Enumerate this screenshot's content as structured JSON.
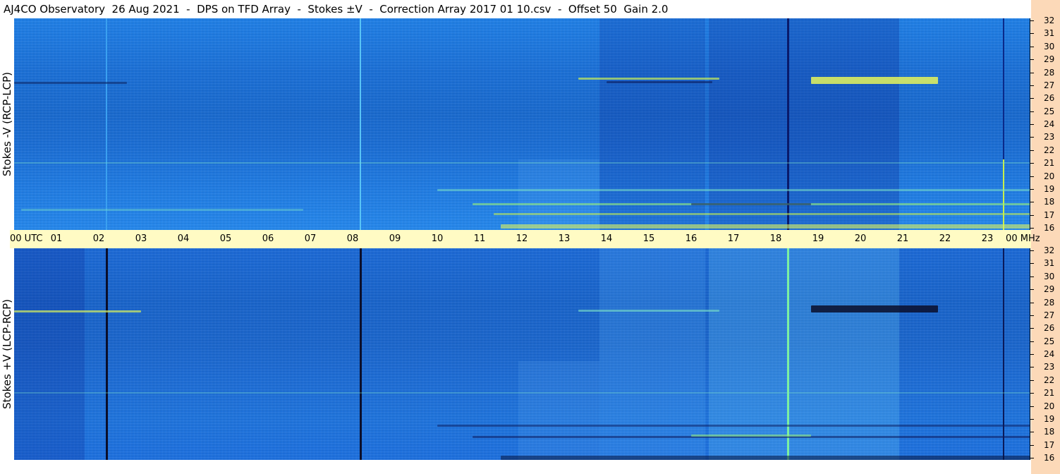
{
  "title": "AJ4CO Observatory  26 Aug 2021  -  DPS on TFD Array  -  Stokes ±V  -  Correction Array 2017 01 10.csv  -  Offset 50  Gain 2.0",
  "panels": {
    "top": {
      "label": "Stokes -V (RCP-LCP)"
    },
    "bottom": {
      "label": "Stokes +V (LCP-RCP)"
    }
  },
  "time_axis": {
    "labels": [
      "00 UTC",
      "01",
      "02",
      "03",
      "04",
      "05",
      "06",
      "07",
      "08",
      "09",
      "10",
      "11",
      "12",
      "13",
      "14",
      "15",
      "16",
      "17",
      "18",
      "19",
      "20",
      "21",
      "22",
      "23",
      "00 MHz"
    ]
  },
  "freq_axis": {
    "labels": [
      "32",
      "31",
      "30",
      "29",
      "28",
      "27",
      "26",
      "25",
      "24",
      "23",
      "22",
      "21",
      "20",
      "19",
      "18",
      "17",
      "16"
    ]
  },
  "colors": {
    "axis_band": "#fffbc4",
    "right_strip": "#fcd9b8",
    "spectrogram_base": "#1a70d8"
  }
}
